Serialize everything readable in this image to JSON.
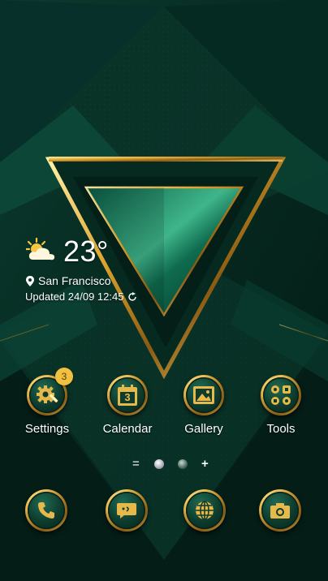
{
  "weather": {
    "icon": "partly-sunny-icon",
    "temperature": "23°",
    "location": "San Francisco",
    "updated": "Updated 24/09 12:45"
  },
  "apps": [
    {
      "label": "Settings",
      "icon": "gear-wrench-icon",
      "badge": "3"
    },
    {
      "label": "Calendar",
      "icon": "calendar-icon",
      "calendar_day": "3"
    },
    {
      "label": "Gallery",
      "icon": "image-icon"
    },
    {
      "label": "Tools",
      "icon": "tools-folder-icon"
    }
  ],
  "pager": {
    "left_symbol": "=",
    "right_symbol": "+"
  },
  "dock": [
    {
      "icon": "phone-icon"
    },
    {
      "icon": "messages-icon"
    },
    {
      "icon": "browser-globe-icon"
    },
    {
      "icon": "camera-icon"
    }
  ],
  "colors": {
    "background": "#05261f",
    "emerald": "#0f6b4f",
    "gold": "#e7b84a",
    "text": "#ffffff",
    "badge": "#f0c040"
  }
}
